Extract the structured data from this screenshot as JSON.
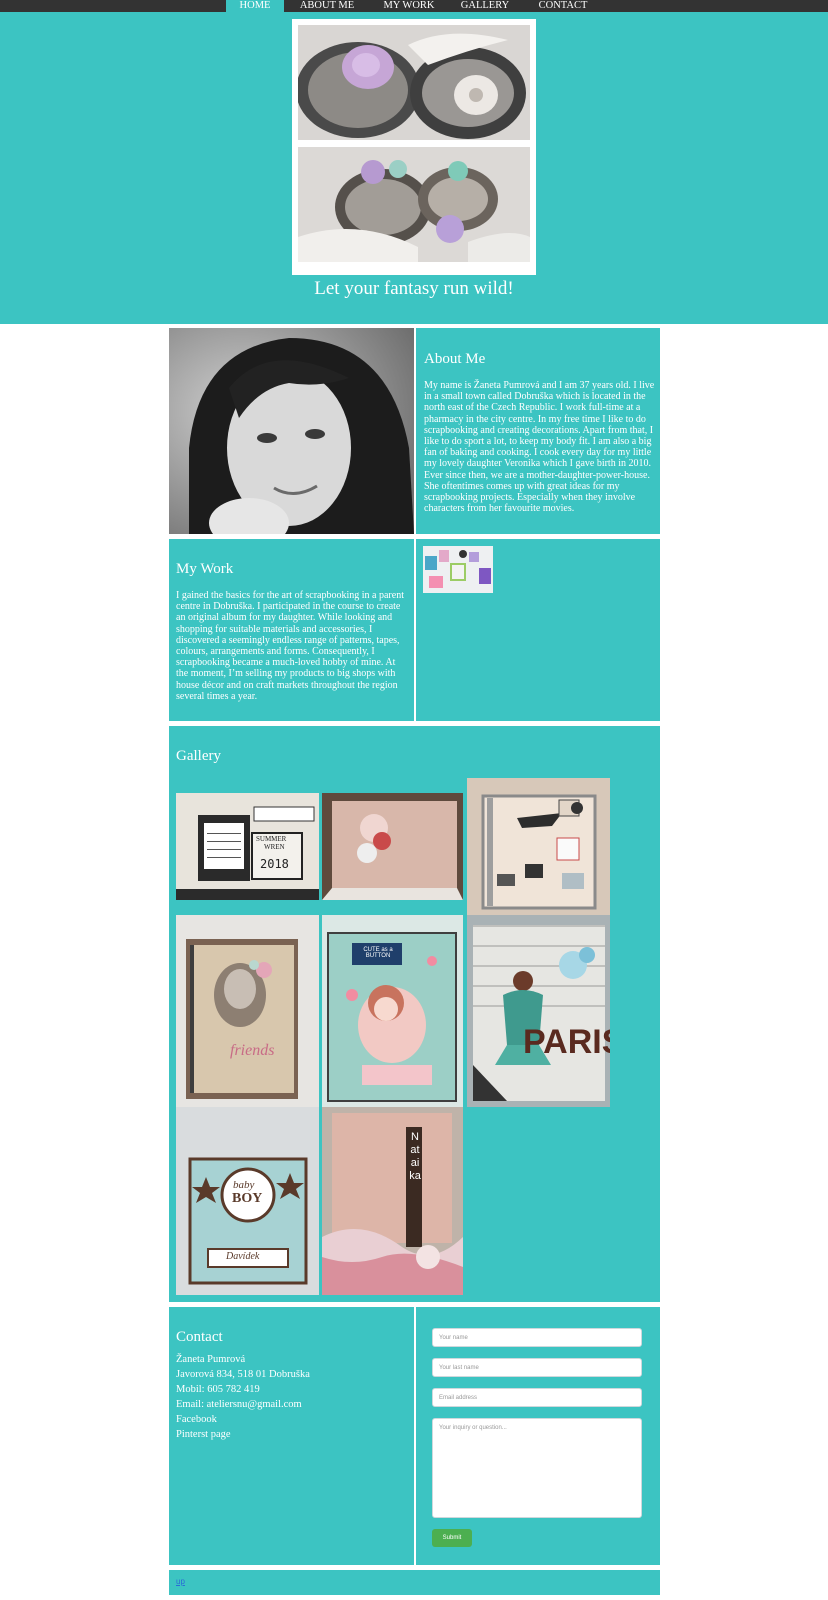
{
  "nav": {
    "items": [
      "HOME",
      "ABOUT ME",
      "MY WORK",
      "GALLERY",
      "CONTACT"
    ],
    "active_index": 0
  },
  "hero": {
    "tagline": "Let your fantasy run wild!"
  },
  "about": {
    "title": "About Me",
    "text": "My name is Žaneta Pumrová and I am 37 years old. I live in a small town called Dobruška which is located in the north east of the Czech Republic. I work full-time at a pharmacy in the city centre. In my free time I like to do scrapbooking and creating decorations. Apart from that, I like to do sport a lot, to keep my body fit. I am also a big fan of baking and cooking. I cook every day for my little my lovely daughter Veronika which I gave birth in 2010. Ever since then, we are a mother-daughter-power-house. She oftentimes comes up with great ideas for my scrapbooking projects. Especially when they involve characters from her favourite movies."
  },
  "work": {
    "title": "My Work",
    "text": "I gained the basics for the art of scrapbooking in a parent centre in Dobruška. I participated in the course to create an original album for my daughter. While looking and shopping for suitable materials and accessories, I discovered a seemingly endless range of patterns, tapes, colours, arrangements and forms. Consequently, I scrapbooking became a much-loved hobby of mine. At the moment, I’m selling my products to big shops with house décor and on craft markets throughout the region several times a year."
  },
  "gallery": {
    "title": "Gallery",
    "calendar_text": [
      "SUMMER",
      "WREN",
      "2018"
    ],
    "paris_text": "PARIS",
    "cute_text": "CUTE as a BUTTON",
    "baby_text": [
      "baby",
      "BOY",
      "Davídek"
    ],
    "nataika_text": "Nataika"
  },
  "contact": {
    "title": "Contact",
    "lines": [
      "Žaneta Pumrová",
      "Javorová 834, 518 01 Dobruška",
      "Mobil: 605 782 419",
      "Email: ateliersnu@gmail.com",
      "Facebook",
      "Pinterst page"
    ],
    "form": {
      "name_placeholder": "Your name",
      "lastname_placeholder": "Your last name",
      "email_placeholder": "Email address",
      "message_placeholder": "Your inquiry or question...",
      "submit_label": "Submit"
    }
  },
  "footer": {
    "link": "up"
  },
  "colors": {
    "teal": "#3cc4c2",
    "nav_bg": "#333333",
    "submit": "#4caf50",
    "footer_link": "#2b6bd6"
  }
}
